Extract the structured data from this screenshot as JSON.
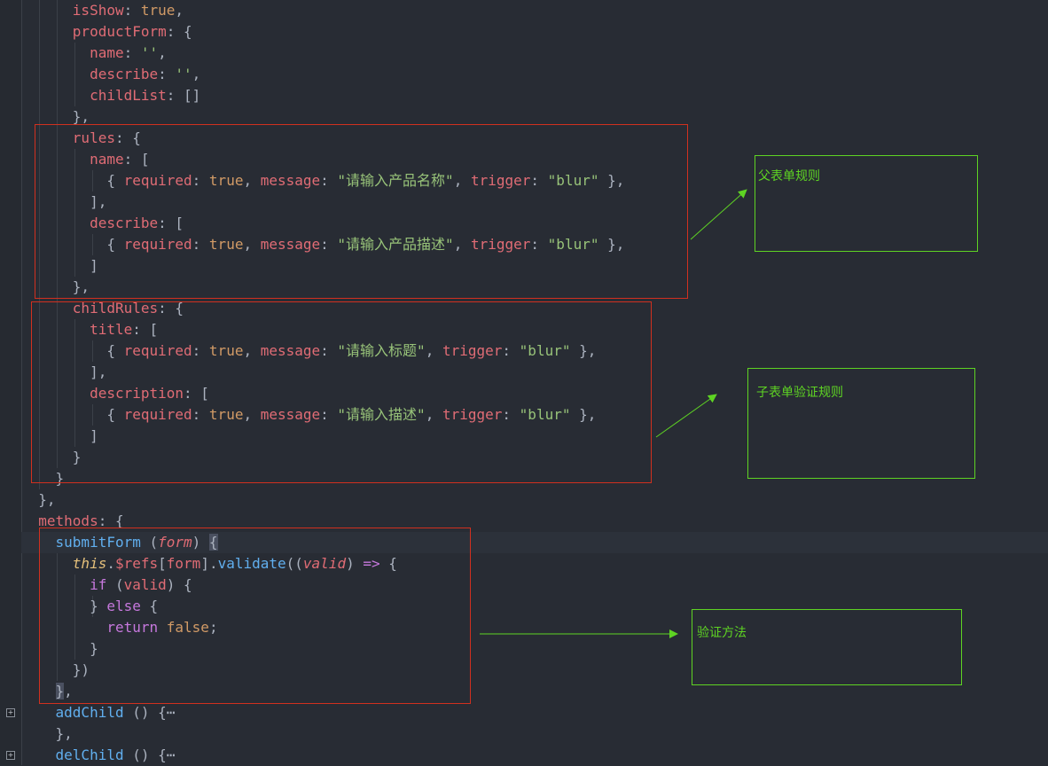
{
  "code": {
    "isShow_key": "isShow",
    "true_lit": "true",
    "false_lit": "false",
    "productForm_key": "productForm",
    "name_key": "name",
    "describe_key": "describe",
    "childList_key": "childList",
    "empty_str": "''",
    "rules_key": "rules",
    "childRules_key": "childRules",
    "title_key": "title",
    "description_key": "description",
    "required_key": "required",
    "message_key": "message",
    "trigger_key": "trigger",
    "blur_str": "\"blur\"",
    "msg_name": "\"请输入产品名称\"",
    "msg_describe": "\"请输入产品描述\"",
    "msg_title": "\"请输入标题\"",
    "msg_description": "\"请输入描述\"",
    "methods_key": "methods",
    "submitForm_fn": "submitForm",
    "form_param": "form",
    "this_kw": "this",
    "refs_prop": "$refs",
    "validate_fn": "validate",
    "valid_param": "valid",
    "arrow_op": "=>",
    "if_kw": "if",
    "else_kw": "else",
    "return_kw": "return",
    "addChild_fn": "addChild",
    "delChild_fn": "delChild",
    "ellipsis": "⋯",
    "fold_glyph": "+"
  },
  "annotations": {
    "parent_rules": "父表单规则",
    "child_rules": "子表单验证规则",
    "validate_method": "验证方法"
  },
  "colors": {
    "background": "#282c34",
    "key": "#e06c75",
    "string": "#98c379",
    "boolean": "#d19a66",
    "function": "#61afef",
    "keyword": "#c678dd",
    "annotation_red": "#d1301f",
    "annotation_green": "#5ed323"
  }
}
